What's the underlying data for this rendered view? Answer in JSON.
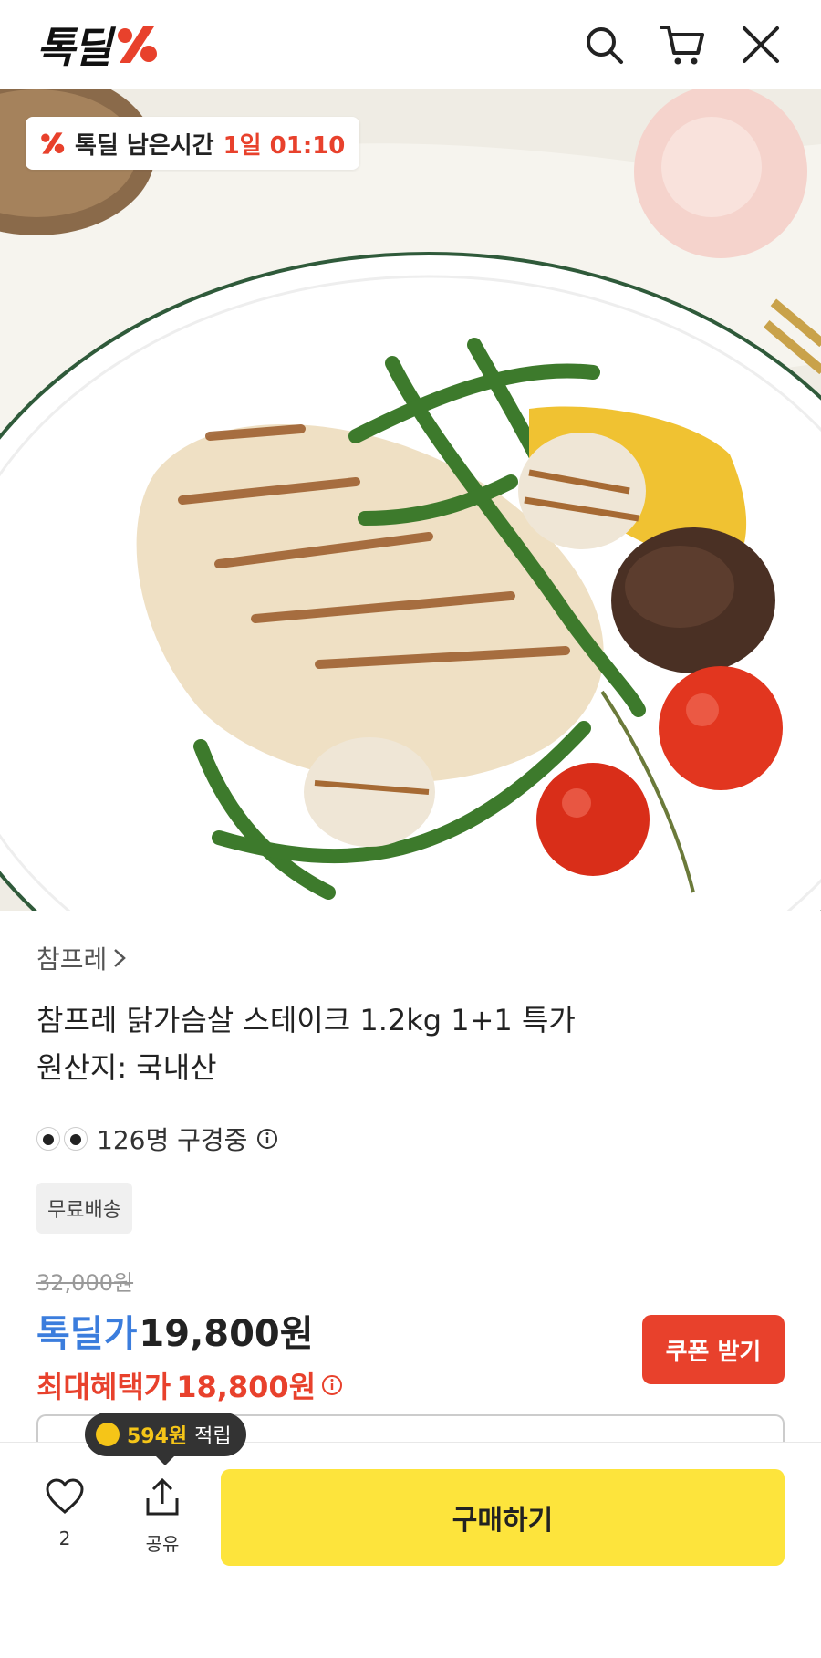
{
  "header": {
    "logo_text": "톡딜",
    "icons": [
      "search-icon",
      "cart-icon",
      "close-icon"
    ],
    "brand_color": "#e8412c"
  },
  "hero": {
    "timer_label": "톡딜 남은시간",
    "timer_value": "1일 01:10"
  },
  "product": {
    "brand": "참프레",
    "title_line1": "참프레 닭가슴살 스테이크 1.2kg 1+1 특가",
    "title_line2": "원산지: 국내산",
    "viewers": "126명 구경중",
    "badge": "무료배송",
    "original_price": "32,000원",
    "deal_label": "톡딜가",
    "deal_price": "19,800원",
    "max_label": "최대혜택가",
    "max_price": "18,800원",
    "coupon_button": "쿠폰 받기"
  },
  "bottom_bar": {
    "tooltip_amount": "594원",
    "tooltip_text": "적립",
    "like_count": "2",
    "share_label": "공유",
    "buy_button": "구매하기"
  },
  "colors": {
    "accent_red": "#e8412c",
    "deal_blue": "#3b7ddd",
    "buy_yellow": "#fde43c"
  }
}
